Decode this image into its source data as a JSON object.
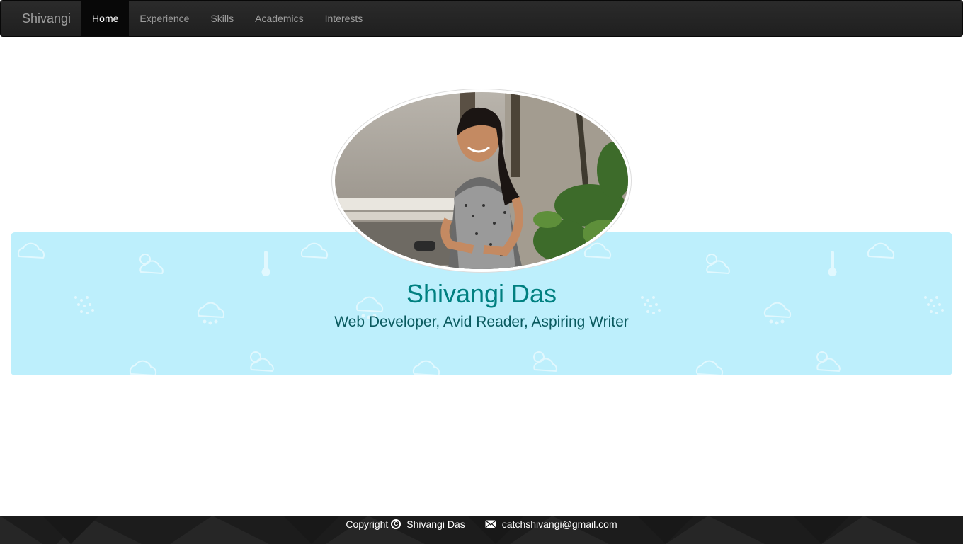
{
  "nav": {
    "brand": "Shivangi",
    "items": [
      {
        "label": "Home",
        "active": true
      },
      {
        "label": "Experience",
        "active": false
      },
      {
        "label": "Skills",
        "active": false
      },
      {
        "label": "Academics",
        "active": false
      },
      {
        "label": "Interests",
        "active": false
      }
    ]
  },
  "hero": {
    "name": "Shivangi Das",
    "tagline": "Web Developer, Avid Reader, Aspiring Writer"
  },
  "footer": {
    "copyright_label": "Copyright",
    "copyright_symbol": "C",
    "owner": "Shivangi Das",
    "email": "catchshivangi@gmail.com"
  },
  "icons": {
    "copyright": "copyright-icon",
    "mail": "mail-icon",
    "weather_pattern": "weather-pattern-icons"
  },
  "colors": {
    "navbar_bg": "#222222",
    "nav_active_bg": "#080808",
    "jumbotron_bg": "#bdeffc",
    "name_color": "#008080",
    "tagline_color": "#0a5a5f",
    "footer_bg": "#1c1c1c"
  }
}
